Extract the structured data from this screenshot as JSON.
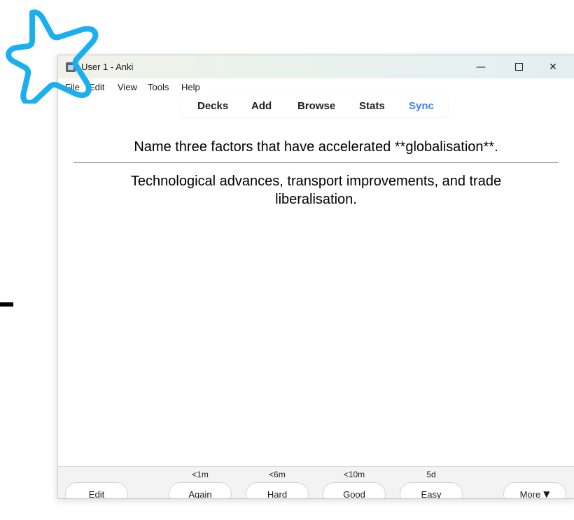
{
  "window": {
    "title": "User 1 - Anki",
    "minimize_glyph": "—",
    "close_glyph": "✕"
  },
  "menu": {
    "items": [
      "File",
      "Edit",
      "View",
      "Tools",
      "Help"
    ]
  },
  "toolbar": {
    "items": [
      "Decks",
      "Add",
      "Browse",
      "Stats",
      "Sync"
    ],
    "accent_color": "#3b82f6"
  },
  "card": {
    "question": "Name three factors that have accelerated **globalisation**.",
    "answer": "Technological advances, transport improvements, and trade liberalisation."
  },
  "bottom": {
    "edit_label": "Edit",
    "more_label": "More",
    "more_arrow": "▼",
    "answers": [
      {
        "label": "Again",
        "interval": "<1m"
      },
      {
        "label": "Hard",
        "interval": "<6m"
      },
      {
        "label": "Good",
        "interval": "<10m"
      },
      {
        "label": "Easy",
        "interval": "5d"
      }
    ]
  },
  "overlay": {
    "star_icon": "star-outline-icon",
    "star_color": "#1ab0f0"
  }
}
